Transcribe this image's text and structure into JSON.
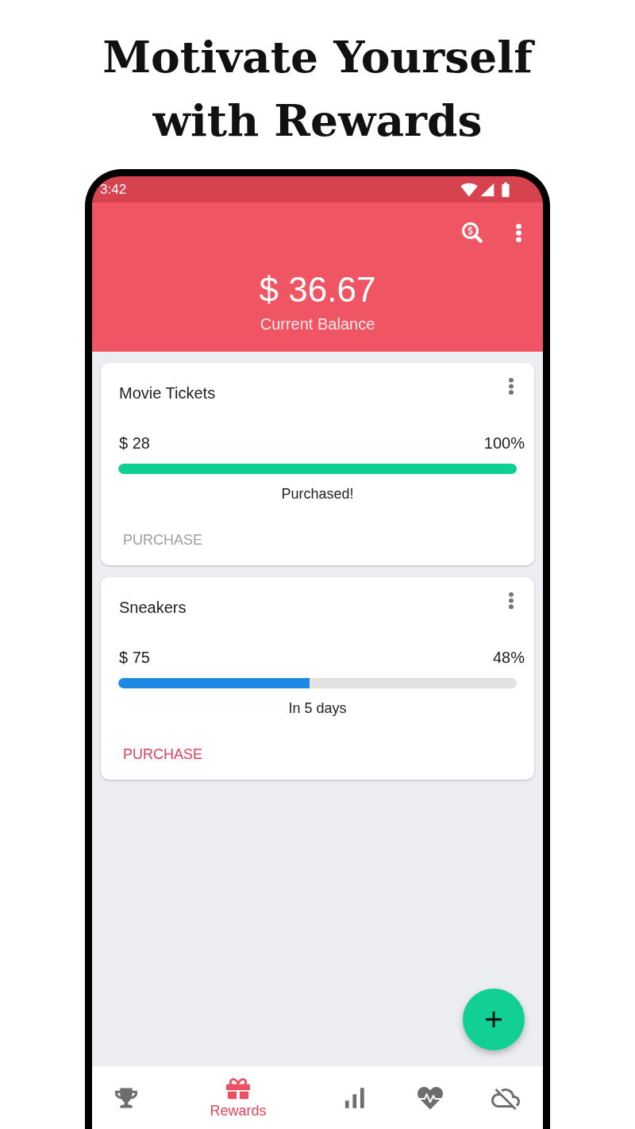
{
  "headline": "Motivate Yourself with Rewards",
  "status_bar": {
    "time": "3:42"
  },
  "header": {
    "balance": "$ 36.67",
    "caption": "Current Balance"
  },
  "rewards": [
    {
      "name": "Movie Tickets",
      "price": "$ 28",
      "percent": "100%",
      "level": 1,
      "color": "#10cf94",
      "status": "Purchased!",
      "action": "PURCHASE",
      "disabled": true
    },
    {
      "name": "Sneakers",
      "price": "$ 75",
      "percent": "48%",
      "level": 0.48,
      "color": "#1e88e5",
      "status": "In 5 days",
      "action": "PURCHASE",
      "disabled": false
    }
  ],
  "bottom_nav": {
    "items": [
      {
        "selected": false
      },
      {
        "label": "Rewards",
        "selected": true
      },
      {
        "selected": false
      },
      {
        "selected": false
      },
      {
        "selected": false
      }
    ]
  }
}
